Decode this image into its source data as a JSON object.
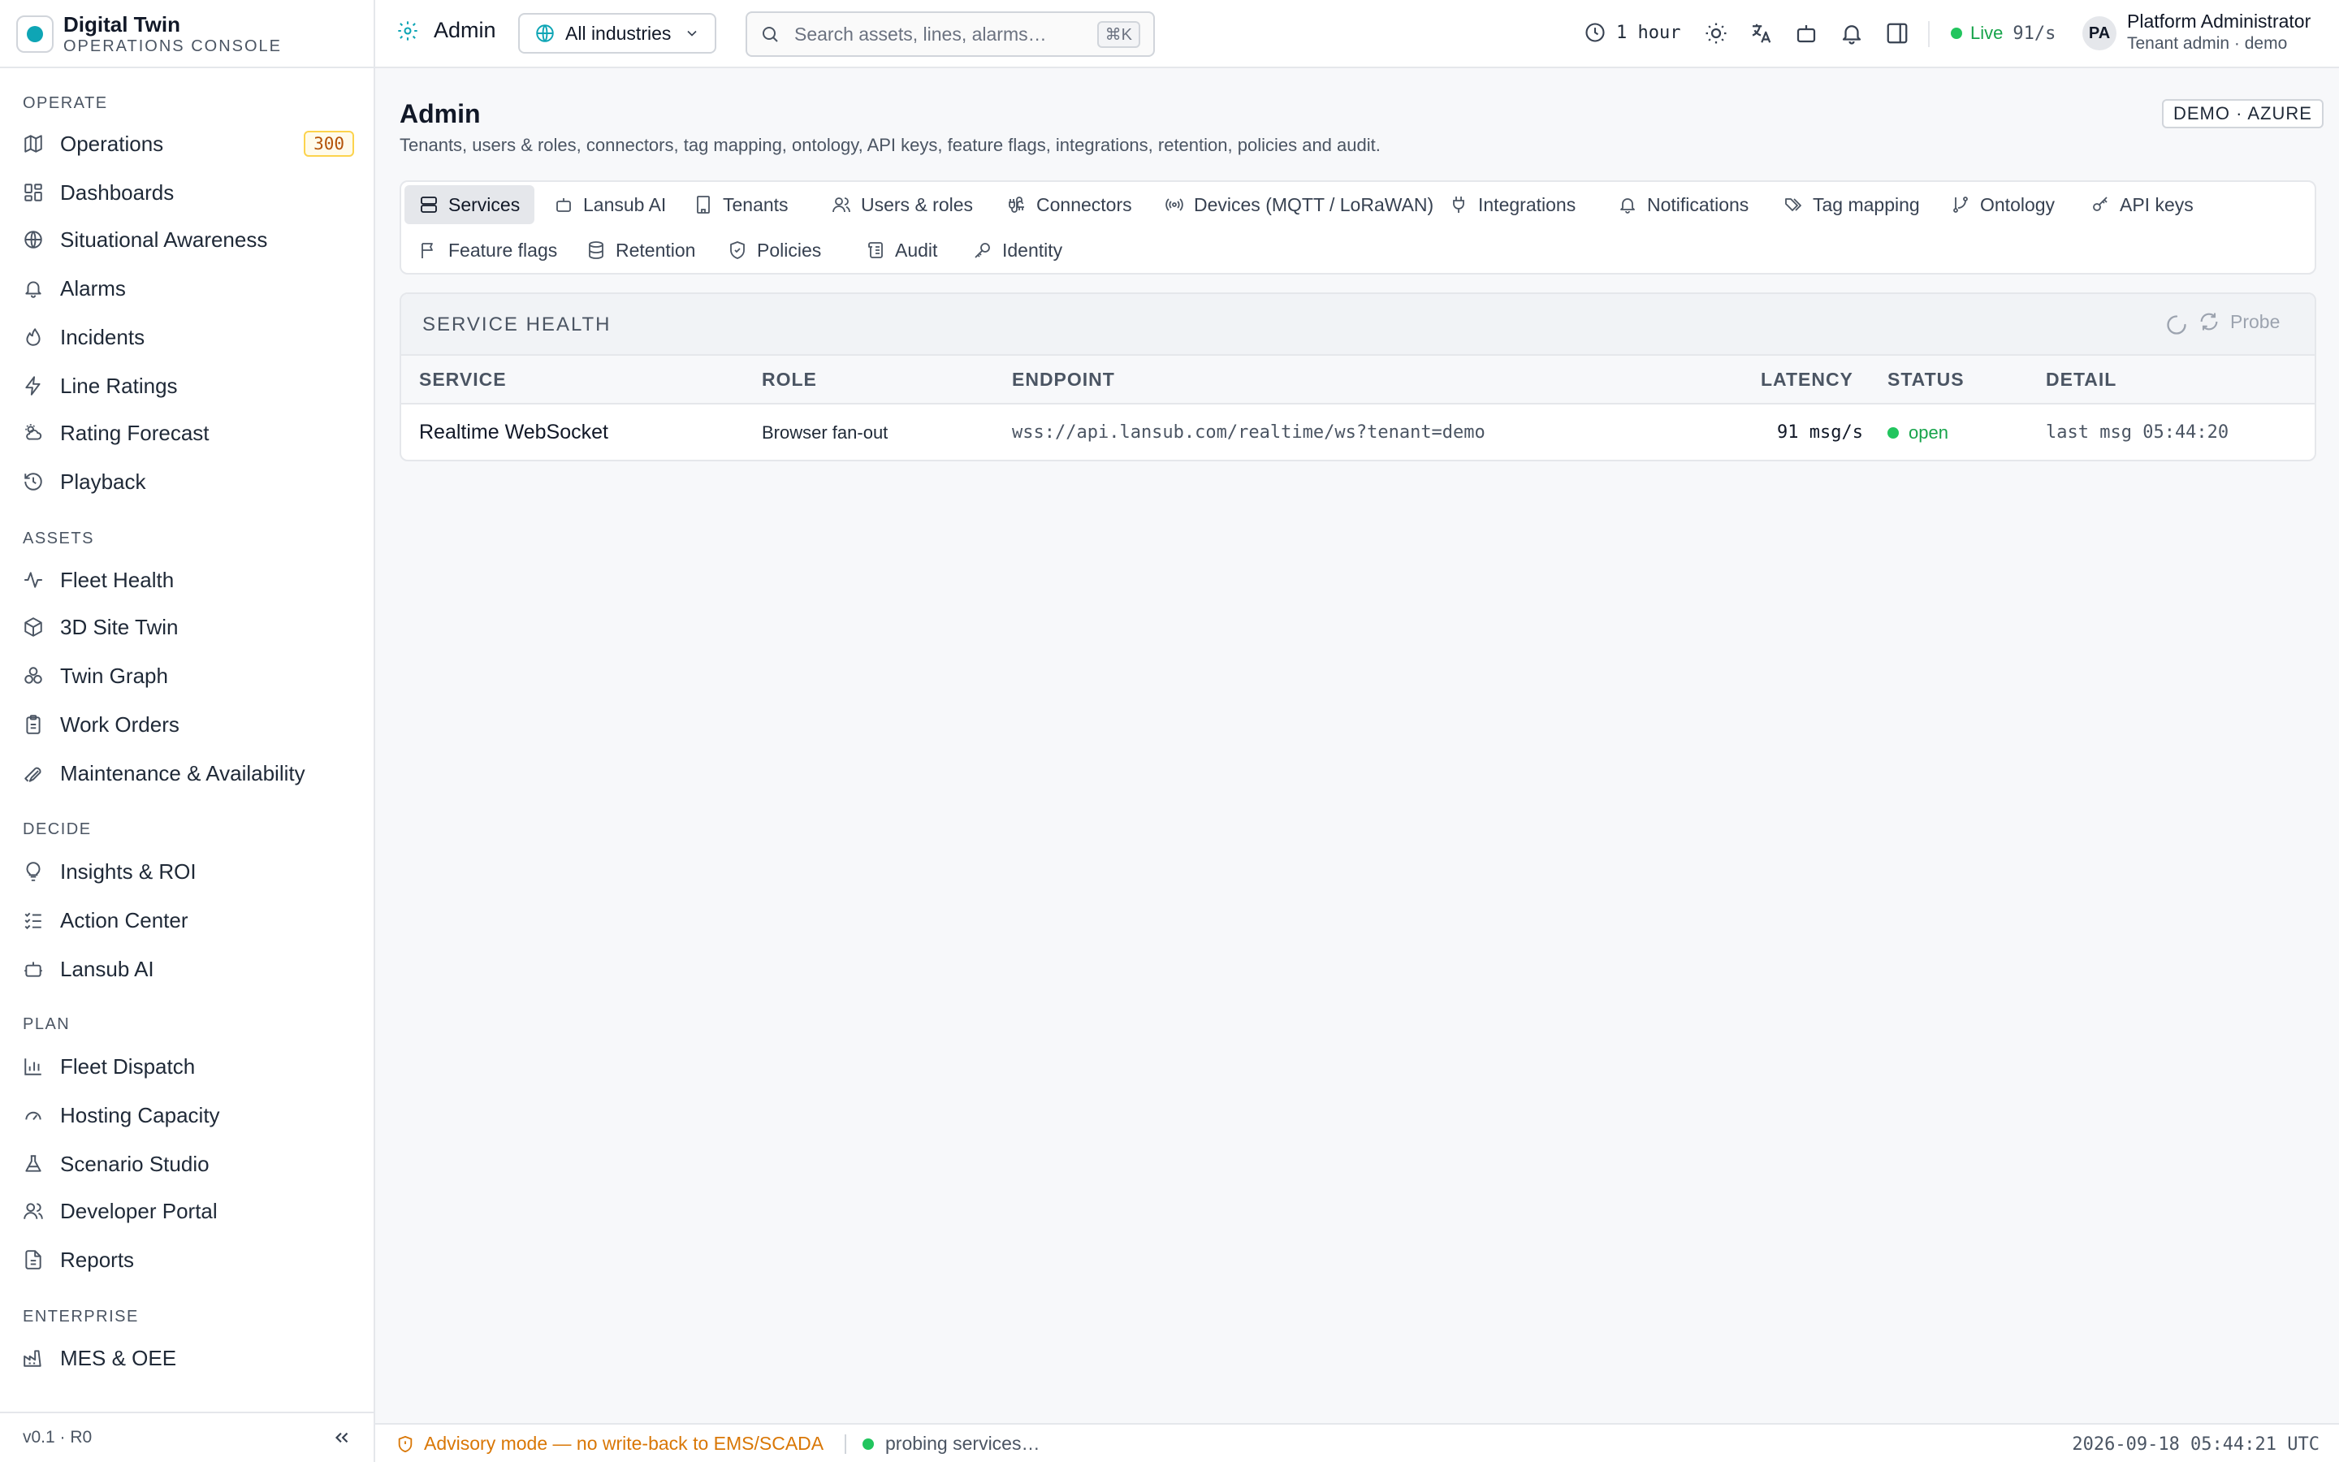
{
  "brand": {
    "title": "Digital Twin",
    "subtitle": "OPERATIONS CONSOLE"
  },
  "sidebar": {
    "sections": [
      {
        "label": "OPERATE",
        "items": [
          {
            "label": "Operations",
            "icon": "map-icon",
            "badge": "300"
          },
          {
            "label": "Dashboards",
            "icon": "grid-icon"
          },
          {
            "label": "Situational Awareness",
            "icon": "globe-icon"
          },
          {
            "label": "Alarms",
            "icon": "bell-icon"
          },
          {
            "label": "Incidents",
            "icon": "flame-icon"
          },
          {
            "label": "Line Ratings",
            "icon": "bolt-icon"
          },
          {
            "label": "Rating Forecast",
            "icon": "cloud-sun-icon"
          },
          {
            "label": "Playback",
            "icon": "history-icon"
          }
        ]
      },
      {
        "label": "ASSETS",
        "items": [
          {
            "label": "Fleet Health",
            "icon": "activity-icon"
          },
          {
            "label": "3D Site Twin",
            "icon": "cube-icon"
          },
          {
            "label": "Twin Graph",
            "icon": "graph-icon"
          },
          {
            "label": "Work Orders",
            "icon": "clipboard-icon"
          },
          {
            "label": "Maintenance & Availability",
            "icon": "wrench-icon"
          }
        ]
      },
      {
        "label": "DECIDE",
        "items": [
          {
            "label": "Insights & ROI",
            "icon": "lightbulb-icon"
          },
          {
            "label": "Action Center",
            "icon": "list-check-icon"
          },
          {
            "label": "Lansub AI",
            "icon": "bot-icon"
          }
        ]
      },
      {
        "label": "PLAN",
        "items": [
          {
            "label": "Fleet Dispatch",
            "icon": "bar-chart-icon"
          },
          {
            "label": "Hosting Capacity",
            "icon": "gauge-icon"
          },
          {
            "label": "Scenario Studio",
            "icon": "flask-icon"
          },
          {
            "label": "Developer Portal",
            "icon": "users-icon"
          },
          {
            "label": "Reports",
            "icon": "file-icon"
          }
        ]
      },
      {
        "label": "ENTERPRISE",
        "items": [
          {
            "label": "MES & OEE",
            "icon": "factory-icon"
          }
        ]
      }
    ],
    "version": "v0.1 · R0",
    "collapse_icon": "chevrons-left-icon"
  },
  "topbar": {
    "page": "Admin",
    "industry": "All industries",
    "search_placeholder": "Search assets, lines, alarms…",
    "search_shortcut": "⌘K",
    "time_range": "1 hour",
    "live_label": "Live",
    "live_rate": "91/s",
    "user_initials": "PA",
    "user_name": "Platform Administrator",
    "user_role": "Tenant admin · demo"
  },
  "main": {
    "title": "Admin",
    "subtitle": "Tenants, users & roles, connectors, tag mapping, ontology, API keys, feature flags, integrations, retention, policies and audit.",
    "env_badge": "DEMO · AZURE",
    "tabs": [
      {
        "label": "Services",
        "icon": "server-icon",
        "active": true
      },
      {
        "label": "Lansub AI",
        "icon": "bot-icon"
      },
      {
        "label": "Tenants",
        "icon": "building-icon"
      },
      {
        "label": "Users & roles",
        "icon": "users-icon"
      },
      {
        "label": "Connectors",
        "icon": "cable-icon"
      },
      {
        "label": "Devices (MQTT / LoRaWAN)",
        "icon": "radio-icon"
      },
      {
        "label": "Integrations",
        "icon": "plug-icon"
      },
      {
        "label": "Notifications",
        "icon": "bell-icon"
      },
      {
        "label": "Tag mapping",
        "icon": "tags-icon"
      },
      {
        "label": "Ontology",
        "icon": "git-branch-icon"
      },
      {
        "label": "API keys",
        "icon": "key-icon"
      },
      {
        "label": "Feature flags",
        "icon": "flag-icon"
      },
      {
        "label": "Retention",
        "icon": "database-icon"
      },
      {
        "label": "Policies",
        "icon": "shield-icon"
      },
      {
        "label": "Audit",
        "icon": "scroll-icon"
      },
      {
        "label": "Identity",
        "icon": "key-round-icon"
      }
    ],
    "service_health": {
      "title": "SERVICE HEALTH",
      "probe_label": "Probe",
      "columns": [
        "SERVICE",
        "ROLE",
        "ENDPOINT",
        "LATENCY",
        "STATUS",
        "DETAIL"
      ],
      "rows": [
        {
          "service": "Realtime WebSocket",
          "role": "Browser fan-out",
          "endpoint": "wss://api.lansub.com/realtime/ws?tenant=demo",
          "latency": "91 msg/s",
          "status": "open",
          "detail": "last msg 05:44:20"
        }
      ]
    }
  },
  "footer": {
    "advisory": "Advisory mode — no write-back to EMS/SCADA",
    "probing": "probing services…",
    "clock": "2026-09-18 05:44:21 UTC"
  },
  "colors": {
    "accent": "#0ea5b5",
    "live": "#22c55e",
    "warning": "#d97706",
    "badge": "#b45309"
  }
}
